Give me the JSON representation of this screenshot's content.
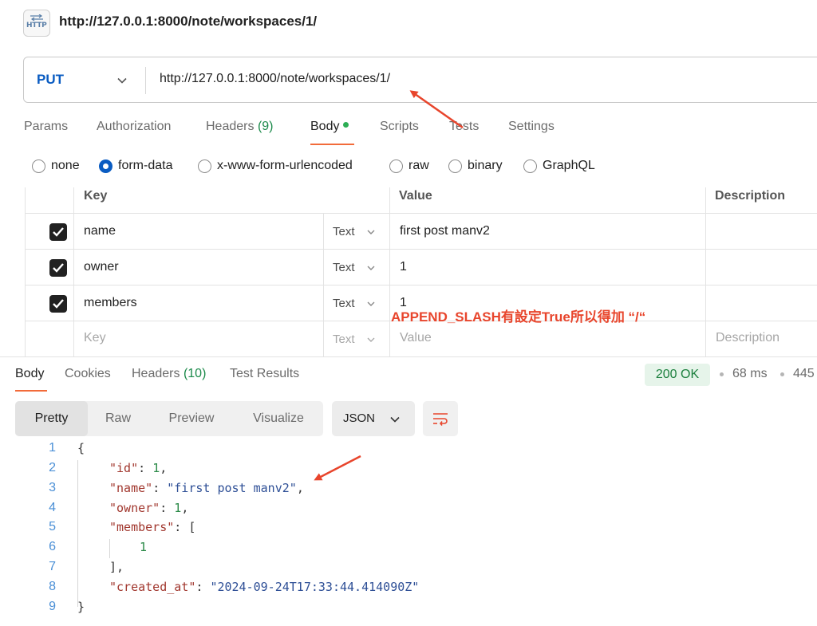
{
  "header": {
    "icon_label": "HTTP",
    "title": "http://127.0.0.1:8000/note/workspaces/1/"
  },
  "request": {
    "method": "PUT",
    "url": "http://127.0.0.1:8000/note/workspaces/1/"
  },
  "request_tabs": [
    {
      "label": "Params"
    },
    {
      "label": "Authorization"
    },
    {
      "label": "Headers",
      "count": "(9)"
    },
    {
      "label": "Body"
    },
    {
      "label": "Scripts"
    },
    {
      "label": "Tests"
    },
    {
      "label": "Settings"
    }
  ],
  "body_types": [
    {
      "label": "none",
      "checked": false
    },
    {
      "label": "form-data",
      "checked": true
    },
    {
      "label": "x-www-form-urlencoded",
      "checked": false
    },
    {
      "label": "raw",
      "checked": false
    },
    {
      "label": "binary",
      "checked": false
    },
    {
      "label": "GraphQL",
      "checked": false
    }
  ],
  "form_table": {
    "headers": {
      "key": "Key",
      "value": "Value",
      "description": "Description"
    },
    "rows": [
      {
        "checked": true,
        "key": "name",
        "type": "Text",
        "value": "first post manv2"
      },
      {
        "checked": true,
        "key": "owner",
        "type": "Text",
        "value": "1"
      },
      {
        "checked": true,
        "key": "members",
        "type": "Text",
        "value": "1"
      }
    ],
    "placeholder_row": {
      "key": "Key",
      "type": "Text",
      "value": "Value",
      "description": "Description"
    }
  },
  "annotation": {
    "text": "APPEND_SLASH有設定True所以得加 “/“",
    "color": "#e8452c"
  },
  "response_tabs": [
    {
      "label": "Body"
    },
    {
      "label": "Cookies"
    },
    {
      "label": "Headers",
      "count": "(10)"
    },
    {
      "label": "Test Results"
    }
  ],
  "response_meta": {
    "status": "200 OK",
    "time": "68 ms",
    "size": "445"
  },
  "view_modes": [
    "Pretty",
    "Raw",
    "Preview",
    "Visualize"
  ],
  "format": "JSON",
  "code_lines": {
    "1": "1",
    "2": "2",
    "3": "3",
    "4": "4",
    "5": "5",
    "6": "6",
    "7": "7",
    "8": "8",
    "9": "9"
  },
  "json": {
    "open": "{",
    "close": "}",
    "id_key": "\"id\"",
    "id_val": "1",
    "name_key": "\"name\"",
    "name_val": "\"first post manv2\"",
    "owner_key": "\"owner\"",
    "owner_val": "1",
    "members_key": "\"members\"",
    "members_item": "1",
    "created_key": "\"created_at\"",
    "created_val": "\"2024-09-24T17:33:44.414090Z\""
  },
  "colors": {
    "accent": "#f26b3a",
    "method": "#0a5cc2",
    "status_ok": "#1b7f3d"
  }
}
